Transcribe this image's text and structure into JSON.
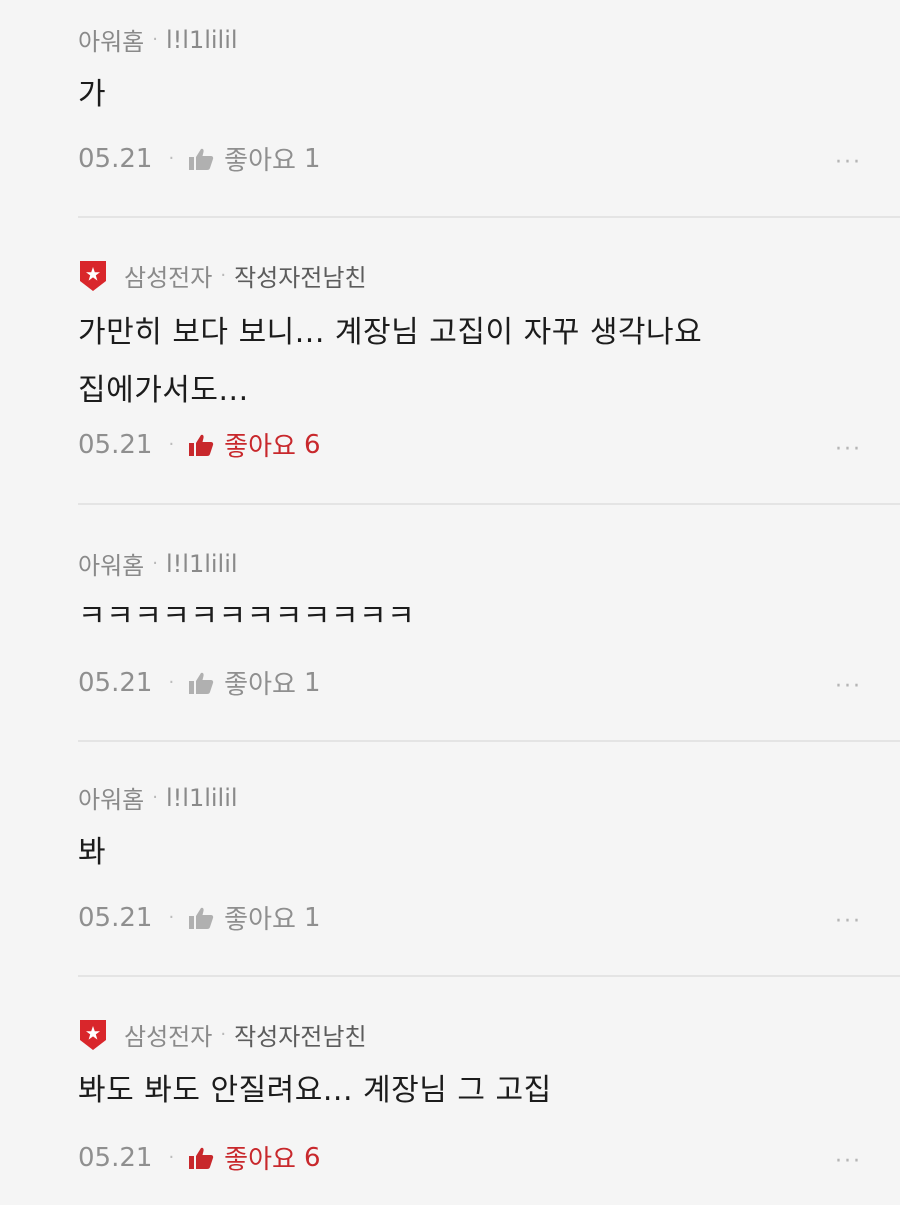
{
  "colors": {
    "background": "#f5f5f5",
    "liked": "#c8282c",
    "muted": "#8f8f8f",
    "badge": "#d9262b"
  },
  "comments": [
    {
      "company": "아워홈",
      "nickname": "l!l1lilil",
      "text": [
        "가"
      ],
      "date": "05.21",
      "like_label": "좋아요",
      "likes": "1",
      "liked": false,
      "more": "···",
      "icon": "none"
    },
    {
      "company": "삼성전자",
      "nickname": "작성자전남친",
      "text": [
        "가만히 보다 보니... 계장님 고집이 자꾸 생각나요",
        "집에가서도..."
      ],
      "date": "05.21",
      "like_label": "좋아요",
      "likes": "6",
      "liked": true,
      "more": "···",
      "icon": "company-badge-icon"
    },
    {
      "company": "아워홈",
      "nickname": "l!l1lilil",
      "text": [
        "ㅋㅋㅋㅋㅋㅋㅋㅋㅋㅋㅋㅋ"
      ],
      "date": "05.21",
      "like_label": "좋아요",
      "likes": "1",
      "liked": false,
      "more": "···",
      "icon": "none"
    },
    {
      "company": "아워홈",
      "nickname": "l!l1lilil",
      "text": [
        "봐"
      ],
      "date": "05.21",
      "like_label": "좋아요",
      "likes": "1",
      "liked": false,
      "more": "···",
      "icon": "none"
    },
    {
      "company": "삼성전자",
      "nickname": "작성자전남친",
      "text": [
        "봐도 봐도 안질려요... 계장님 그 고집"
      ],
      "date": "05.21",
      "like_label": "좋아요",
      "likes": "6",
      "liked": true,
      "more": "···",
      "icon": "company-badge-icon"
    }
  ]
}
